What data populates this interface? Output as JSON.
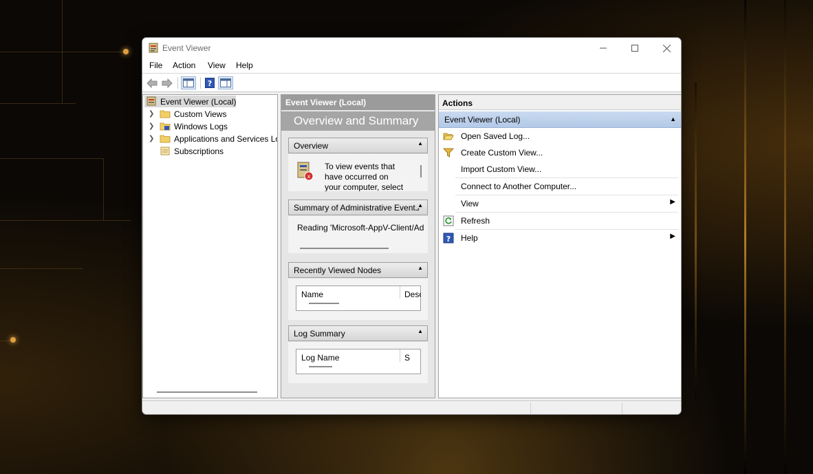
{
  "window": {
    "title": "Event Viewer"
  },
  "menu": [
    "File",
    "Action",
    "View",
    "Help"
  ],
  "tree": {
    "root": "Event Viewer (Local)",
    "items": [
      "Custom Views",
      "Windows Logs",
      "Applications and Services Lo",
      "Subscriptions"
    ]
  },
  "middle": {
    "header": "Event Viewer (Local)",
    "banner": "Overview and Summary",
    "overview": {
      "title": "Overview",
      "text_lines": [
        "To view events that",
        "have occurred on",
        "your computer, select"
      ]
    },
    "admin_summary": {
      "title": "Summary of Administrative Events",
      "text": "Reading 'Microsoft-AppV-Client/Ad"
    },
    "recent_nodes": {
      "title": "Recently Viewed Nodes",
      "columns": [
        "Name",
        "Desc"
      ]
    },
    "log_summary": {
      "title": "Log Summary",
      "columns": [
        "Log Name",
        "S"
      ]
    }
  },
  "actions": {
    "header": "Actions",
    "group": "Event Viewer (Local)",
    "items": [
      {
        "label": "Open Saved Log...",
        "icon": "folder-open-icon"
      },
      {
        "label": "Create Custom View...",
        "icon": "filter-funnel-icon"
      },
      {
        "label": "Import Custom View...",
        "icon": ""
      },
      {
        "label": "Connect to Another Computer...",
        "icon": ""
      },
      {
        "label": "View",
        "icon": "",
        "submenu": true
      },
      {
        "label": "Refresh",
        "icon": "refresh-icon"
      },
      {
        "label": "Help",
        "icon": "help-icon",
        "submenu": true
      }
    ]
  },
  "colors": {
    "accent_blue": "#c9daf0",
    "header_gray": "#9b9b9b"
  }
}
